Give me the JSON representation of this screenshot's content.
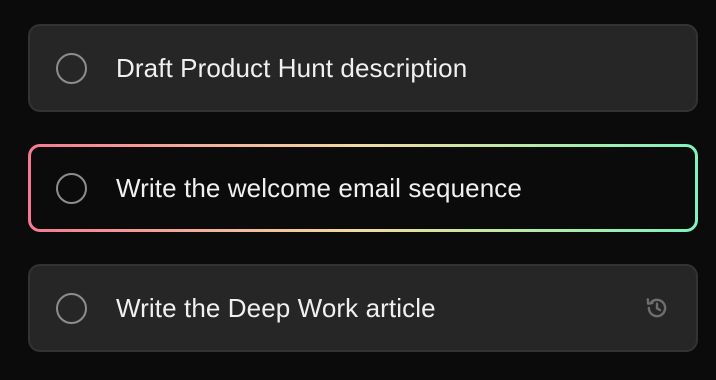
{
  "tasks": [
    {
      "title": "Draft Product Hunt description",
      "completed": false,
      "focused": false
    },
    {
      "title": "Write the welcome email sequence",
      "completed": false,
      "focused": true
    },
    {
      "title": "Write the Deep Work article",
      "completed": false,
      "focused": false,
      "trailing_icon": "history-icon"
    }
  ],
  "colors": {
    "background": "#0b0b0b",
    "card": "#262626",
    "focus_gradient_start": "#f47a92",
    "focus_gradient_mid": "#f0dca0",
    "focus_gradient_end": "#7ff2c0"
  }
}
